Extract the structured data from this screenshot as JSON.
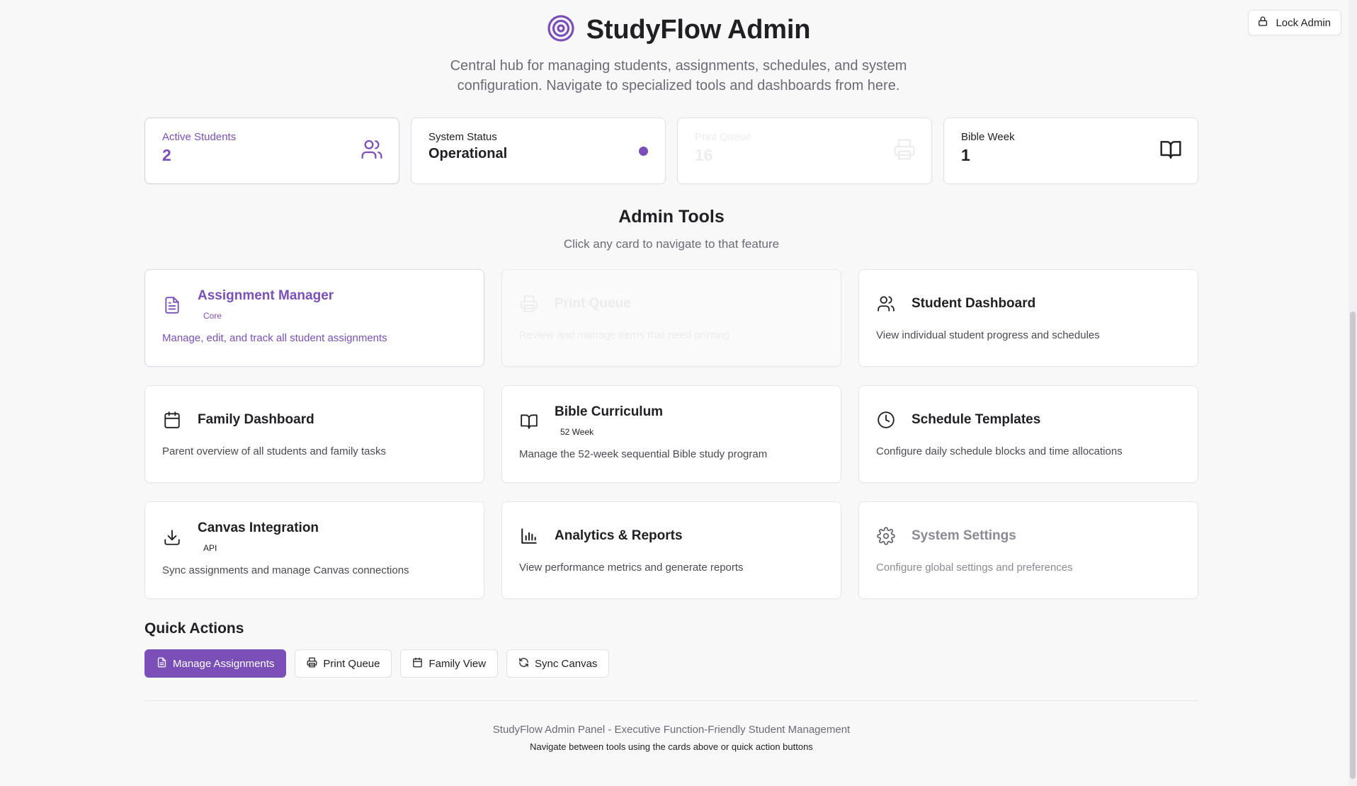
{
  "header": {
    "title": "StudyFlow Admin",
    "subtitle": "Central hub for managing students, assignments, schedules, and system configuration. Navigate to specialized tools and dashboards from here.",
    "lock_label": "Lock Admin"
  },
  "stats": [
    {
      "label": "Active Students",
      "value": "2",
      "icon": "users-icon"
    },
    {
      "label": "System Status",
      "value": "Operational",
      "icon": "status-dot"
    },
    {
      "label": "Print Queue",
      "value": "16",
      "icon": "printer-icon"
    },
    {
      "label": "Bible Week",
      "value": "1",
      "icon": "book-icon"
    }
  ],
  "tools_section": {
    "title": "Admin Tools",
    "subtitle": "Click any card to navigate to that feature"
  },
  "tools": [
    {
      "name": "Assignment Manager",
      "badge": "Core",
      "desc": "Manage, edit, and track all student assignments",
      "icon": "document-icon"
    },
    {
      "name": "Print Queue",
      "badge": "",
      "desc": "Review and manage items that need printing",
      "icon": "printer-icon"
    },
    {
      "name": "Student Dashboard",
      "badge": "",
      "desc": "View individual student progress and schedules",
      "icon": "users-icon"
    },
    {
      "name": "Family Dashboard",
      "badge": "",
      "desc": "Parent overview of all students and family tasks",
      "icon": "calendar-icon"
    },
    {
      "name": "Bible Curriculum",
      "badge": "52 Week",
      "desc": "Manage the 52-week sequential Bible study program",
      "icon": "book-icon"
    },
    {
      "name": "Schedule Templates",
      "badge": "",
      "desc": "Configure daily schedule blocks and time allocations",
      "icon": "clock-icon"
    },
    {
      "name": "Canvas Integration",
      "badge": "API",
      "desc": "Sync assignments and manage Canvas connections",
      "icon": "download-icon"
    },
    {
      "name": "Analytics & Reports",
      "badge": "",
      "desc": "View performance metrics and generate reports",
      "icon": "bar-chart-icon"
    },
    {
      "name": "System Settings",
      "badge": "",
      "desc": "Configure global settings and preferences",
      "icon": "gear-icon"
    }
  ],
  "quick_actions": {
    "title": "Quick Actions",
    "buttons": [
      {
        "label": "Manage Assignments",
        "icon": "document-icon"
      },
      {
        "label": "Print Queue",
        "icon": "printer-icon"
      },
      {
        "label": "Family View",
        "icon": "calendar-icon"
      },
      {
        "label": "Sync Canvas",
        "icon": "refresh-icon"
      }
    ]
  },
  "footer": {
    "line1": "StudyFlow Admin Panel - Executive Function-Friendly Student Management",
    "line2": "Navigate between tools using the cards above or quick action buttons"
  },
  "colors": {
    "accent": "#7b4fb8",
    "text": "#1f1f24",
    "muted": "#6b6b78",
    "background": "#f8f8f9"
  }
}
